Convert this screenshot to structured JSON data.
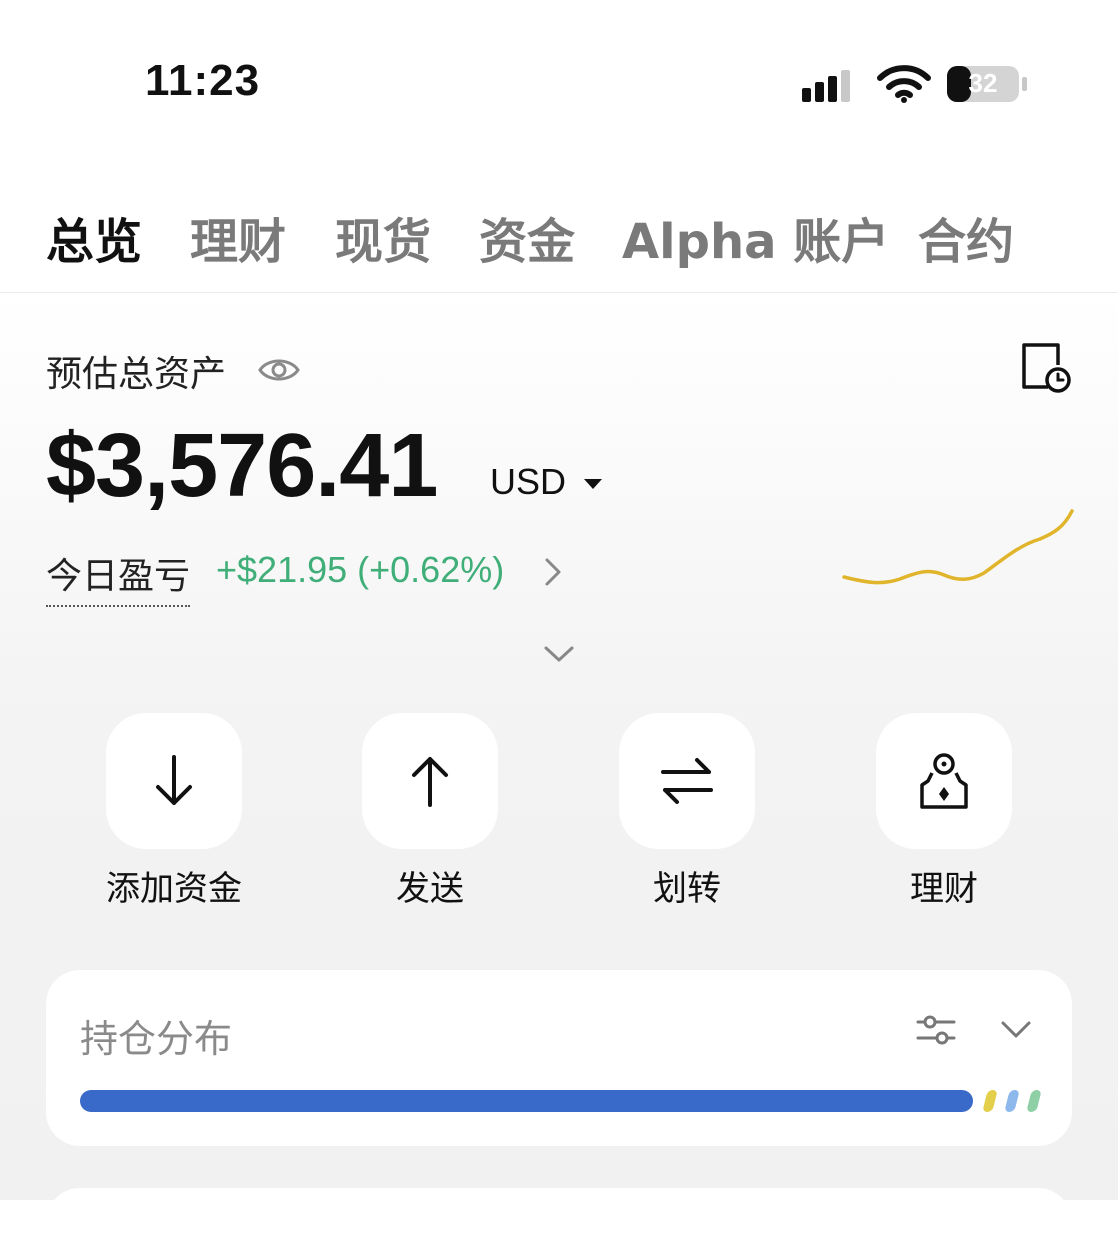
{
  "status_bar": {
    "time": "11:23",
    "battery_level": "32",
    "icons": [
      "signal-icon",
      "wifi-icon",
      "battery-icon"
    ]
  },
  "tabs": [
    {
      "label": "总览",
      "active": true
    },
    {
      "label": "理财",
      "active": false
    },
    {
      "label": "现货",
      "active": false
    },
    {
      "label": "资金",
      "active": false
    },
    {
      "label": "Alpha 账户",
      "active": false
    },
    {
      "label": "合约",
      "active": false
    }
  ],
  "assets": {
    "label": "预估总资产",
    "balance": "$3,576.41",
    "currency": "USD",
    "pnl_label": "今日盈亏",
    "pnl_value": "+$21.95 (+0.62%)",
    "colors": {
      "positive": "#3fae78",
      "sparkline": "#e0b52c"
    }
  },
  "actions": [
    {
      "label": "添加资金",
      "icon": "arrow-down-icon"
    },
    {
      "label": "发送",
      "icon": "arrow-up-icon"
    },
    {
      "label": "划转",
      "icon": "transfer-icon"
    },
    {
      "label": "理财",
      "icon": "earn-icon"
    }
  ],
  "holdings": {
    "title": "持仓分布",
    "allocation": [
      {
        "share": 0.93,
        "color": "#3a6ac9"
      },
      {
        "share": 0.01,
        "color": "#e3cf4a"
      },
      {
        "share": 0.01,
        "color": "#8db8ec"
      },
      {
        "share": 0.01,
        "color": "#8fcfa6"
      }
    ]
  }
}
